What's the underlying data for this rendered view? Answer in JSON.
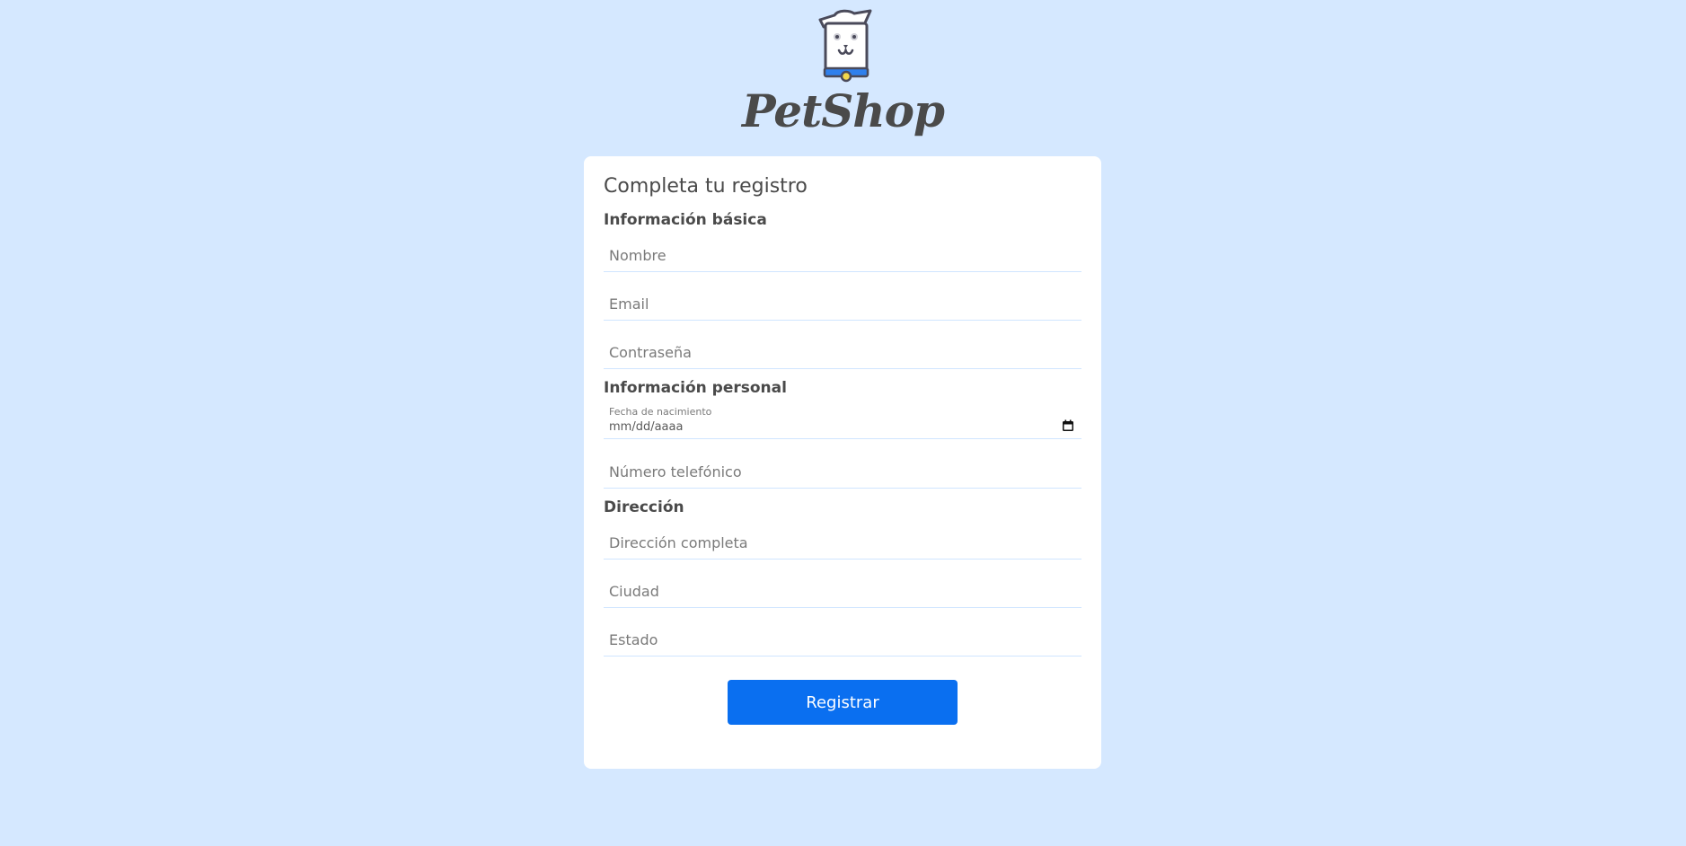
{
  "brand": {
    "name": "PetShop",
    "logo_icon": "dog-logo-icon",
    "colors": {
      "collar": "#2f80ed",
      "tag": "#f2d84b",
      "outline": "#4a4a5a"
    }
  },
  "form": {
    "title": "Completa tu registro",
    "sections": {
      "basic": {
        "title": "Información básica",
        "name_placeholder": "Nombre",
        "email_placeholder": "Email",
        "password_placeholder": "Contraseña"
      },
      "personal": {
        "title": "Información personal",
        "birthdate_label": "Fecha de nacimiento",
        "birthdate_value": "mm/dd/aaaa",
        "phone_placeholder": "Número telefónico"
      },
      "address": {
        "title": "Dirección",
        "full_address_placeholder": "Dirección completa",
        "city_placeholder": "Ciudad",
        "state_placeholder": "Estado"
      }
    },
    "submit_label": "Registrar"
  },
  "theme": {
    "background": "#d5e8ff",
    "card": "#ffffff",
    "primary": "#0a6ff0",
    "field_border": "#d0e5ff"
  }
}
